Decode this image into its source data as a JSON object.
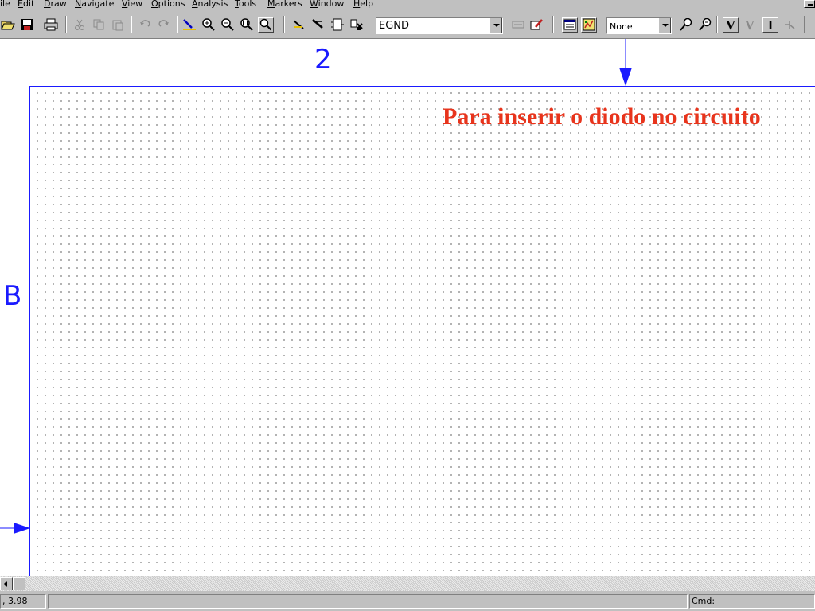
{
  "menu": [
    {
      "pre": "",
      "hk": "",
      "post": "ile"
    },
    {
      "pre": "",
      "hk": "E",
      "post": "dit"
    },
    {
      "pre": "",
      "hk": "D",
      "post": "raw"
    },
    {
      "pre": "",
      "hk": "N",
      "post": "avigate"
    },
    {
      "pre": "",
      "hk": "V",
      "post": "iew"
    },
    {
      "pre": "",
      "hk": "O",
      "post": "ptions"
    },
    {
      "pre": "",
      "hk": "A",
      "post": "nalysis"
    },
    {
      "pre": "",
      "hk": "T",
      "post": "ools"
    },
    {
      "pre": "",
      "hk": "M",
      "post": "arkers"
    },
    {
      "pre": "",
      "hk": "W",
      "post": "indow"
    },
    {
      "pre": "",
      "hk": "H",
      "post": "elp"
    }
  ],
  "toolbar": {
    "part_combo_value": "EGND",
    "sim_combo_value": "None",
    "text_button_labels": [
      "V",
      "V",
      "I"
    ],
    "icons": [
      "open-icon",
      "save-icon",
      "print-icon",
      "cut-icon",
      "copy-icon",
      "paste-icon",
      "undo-icon",
      "redo-icon",
      "draw-wire-icon",
      "zoom-in-icon",
      "zoom-out-icon",
      "zoom-area-icon",
      "zoom-fit-icon",
      "get-part-icon",
      "get-new-part-icon",
      "edit-symbol-icon",
      "place-part-icon",
      "edit-attributes-icon",
      "setup-analysis-icon",
      "simulate-icon",
      "probe-icon",
      "find-icon",
      "bias-point-icon",
      "voltage-display-icon",
      "current-display-icon",
      "current-marker-icon"
    ]
  },
  "canvas": {
    "border_label_top": "2",
    "border_label_left": "B",
    "annotation": "Para inserir o diodo no circuito",
    "annotation_color": "#e8341c",
    "border_color": "#1a1aff"
  },
  "statusbar": {
    "coords": ", 3.98",
    "message": "",
    "cmd_label": "Cmd:"
  }
}
